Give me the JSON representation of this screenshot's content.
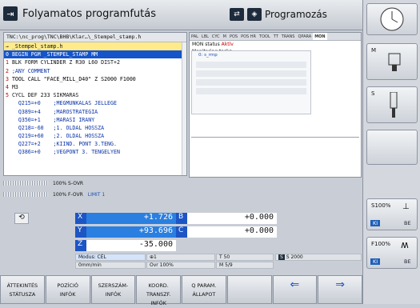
{
  "header": {
    "left_mode": "Folyamatos programfutás",
    "right_mode": "Programozás"
  },
  "program": {
    "path": "TNC:\\nc_prog\\TNC\\BHB\\Klar…\\_Stempel_stamp.h",
    "lines": [
      {
        "n": "→",
        "t": "_Stempel_stamp.h",
        "cls": "cur"
      },
      {
        "n": "0",
        "t": "BEGIN PGM _STEMPEL_STAMP MM",
        "cls": "sel"
      },
      {
        "n": "1",
        "t": "BLK FORM CYLINDER Z R30 L60 DIST+2",
        "cls": ""
      },
      {
        "n": "2",
        "t": ";ANY COMMENT",
        "cls": "cmt"
      },
      {
        "n": "3",
        "t": "TOOL CALL \"FACE_MILL_D40\" Z S2000 F1000",
        "cls": "tool"
      },
      {
        "n": "4",
        "t": "M3",
        "cls": ""
      },
      {
        "n": "5",
        "t": "CYCL DEF 233 SIKMARAS",
        "cls": ""
      },
      {
        "n": "",
        "t": "  Q215=+0    ;MEGMUNKALAS JELLEGE",
        "cls": "q"
      },
      {
        "n": "",
        "t": "  Q389=+4    ;MAROSTRATEGIA",
        "cls": "q"
      },
      {
        "n": "",
        "t": "  Q350=+1    ;MARASI IRANY",
        "cls": "q"
      },
      {
        "n": "",
        "t": "  Q218=-60   ;1. OLDAL HOSSZA",
        "cls": "q"
      },
      {
        "n": "",
        "t": "  Q219=+60   ;2. OLDAL HOSSZA",
        "cls": "q"
      },
      {
        "n": "",
        "t": "  Q227=+2    ;KIIND. PONT 3.TENG.",
        "cls": "q"
      },
      {
        "n": "",
        "t": "  Q386=+0    ;VEGPONT 3. TENGELYEN",
        "cls": "q"
      }
    ]
  },
  "tabs": {
    "items": [
      "PAL",
      "LBL",
      "CYC",
      "M",
      "POS",
      "POS HR",
      "TOOL",
      "TT",
      "TRANS",
      "QPARA",
      "MON"
    ],
    "active": "MON",
    "mon_status_label": "MON status",
    "mon_status_value": "Aktív",
    "monitoring_title": "Monitoring tasks",
    "monitoring_item": "0: s_rmp"
  },
  "overrides": {
    "s_ovr": "100% S-OVR",
    "f_ovr": "100% F-OVR",
    "limit": "LIMIT 1"
  },
  "positions": [
    {
      "axis": "X",
      "value": "+1.726",
      "axis2": "B",
      "value2": "+0.000"
    },
    {
      "axis": "Y",
      "value": "+93.696",
      "axis2": "C",
      "value2": "+0.000"
    },
    {
      "axis": "Z",
      "value": "-35.000"
    }
  ],
  "status": {
    "mode": "Modus: CÉL",
    "t": "T 50",
    "s": "S 2000",
    "f": "0mm/min",
    "ovr": "Ovr 100%",
    "m": "M 5/9"
  },
  "right": {
    "m_label": "M",
    "s_label": "S",
    "s100": "S100%",
    "f100": "F100%",
    "ki": "KI",
    "be": "BE"
  },
  "softkeys": [
    "ÁTTEKINTÉS\nSTÁTUSZA",
    "POZÍCIÓ\nINFÓK",
    "SZERSZÁM-\nINFÓK",
    "KOORD.\nTRANSZF.\nINFÓK",
    "Q PARAM.\nÁLLAPOT",
    "",
    "",
    ""
  ]
}
